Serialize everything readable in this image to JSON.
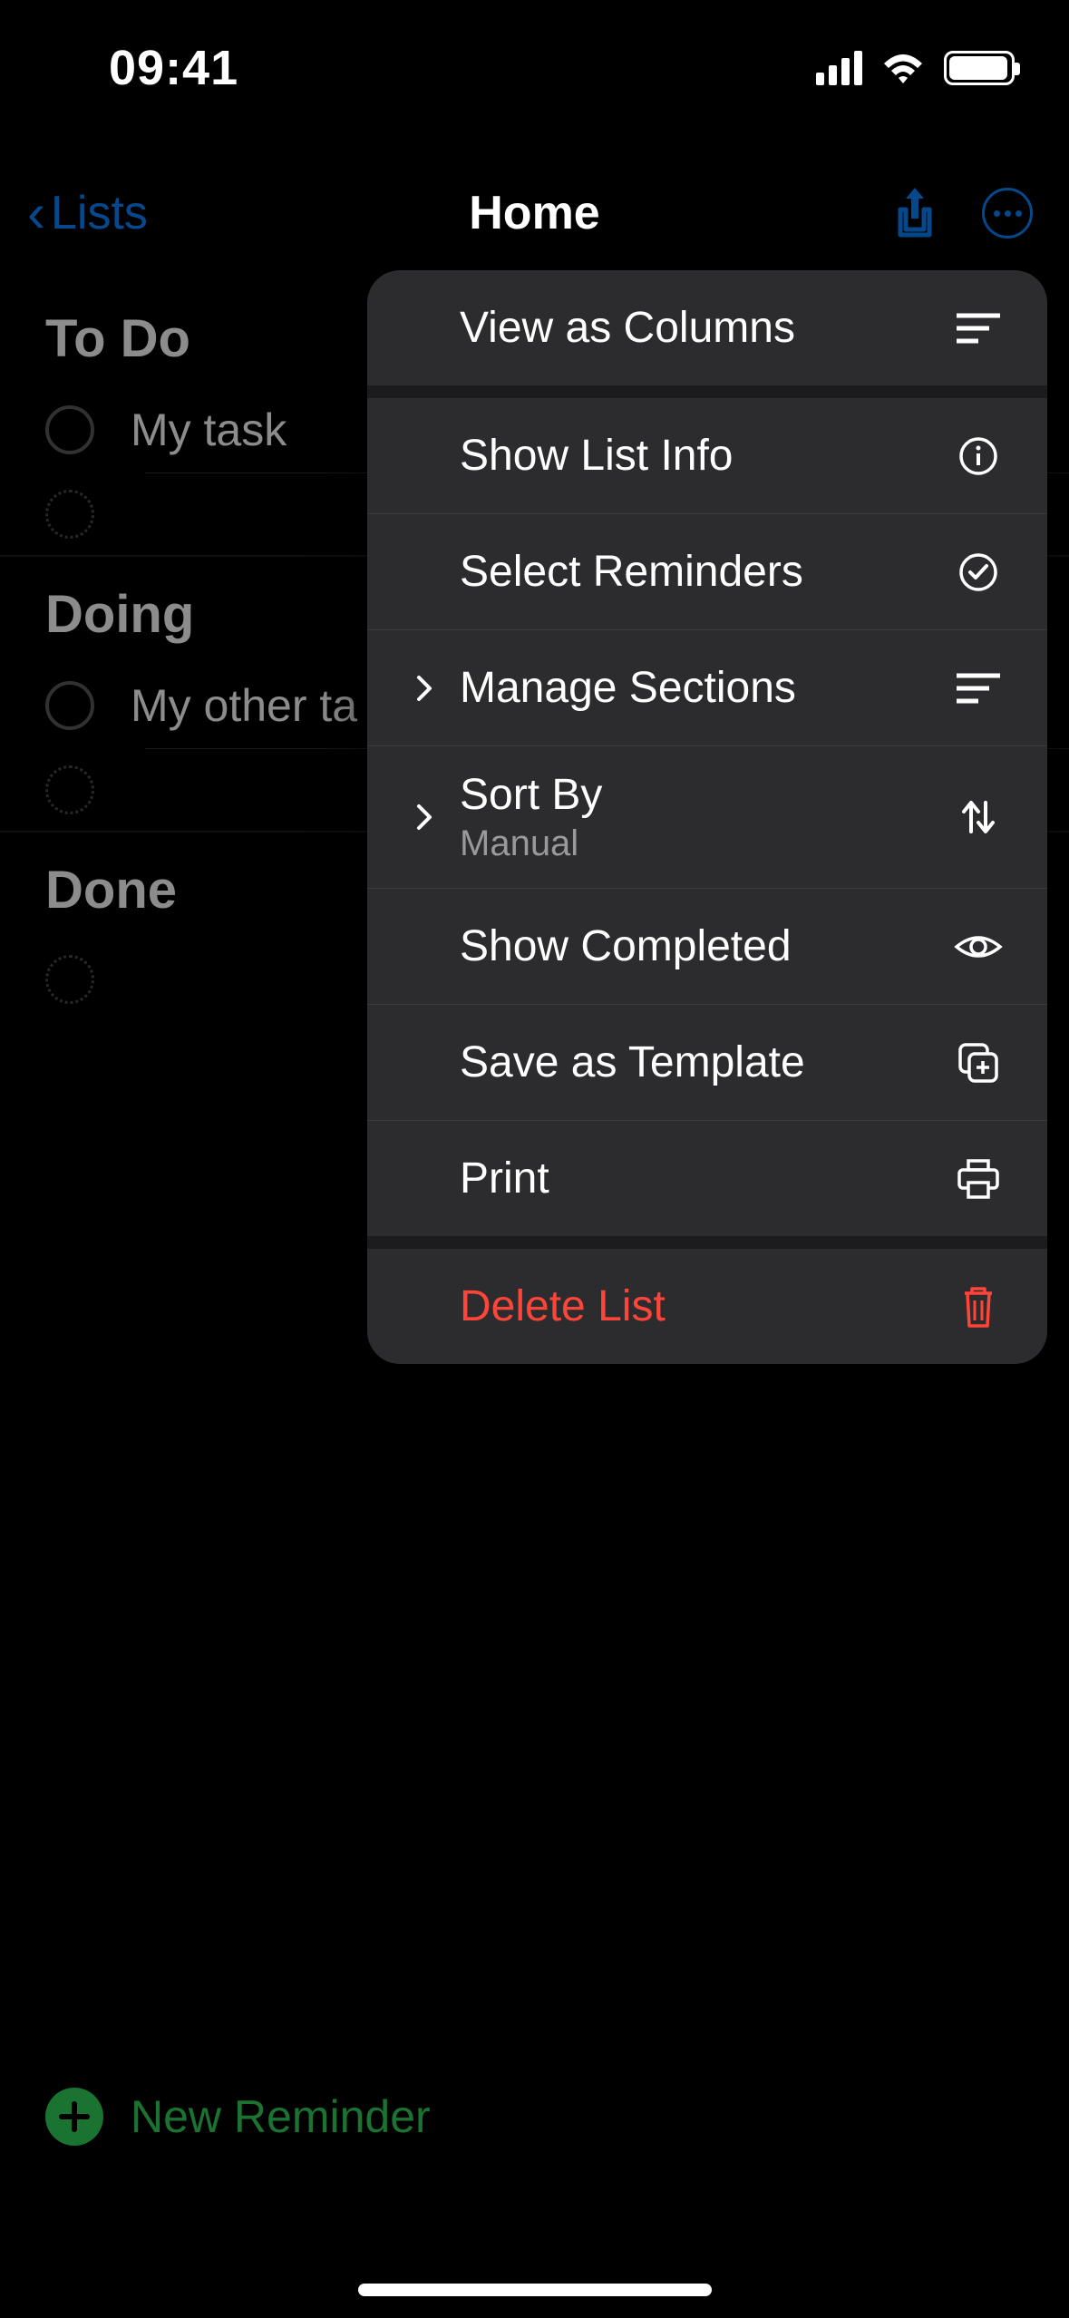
{
  "status": {
    "time": "09:41"
  },
  "nav": {
    "back_label": "Lists",
    "title": "Home"
  },
  "sections": [
    {
      "title": "To Do",
      "items": [
        "My task"
      ]
    },
    {
      "title": "Doing",
      "items": [
        "My other ta"
      ]
    },
    {
      "title": "Done",
      "items": []
    }
  ],
  "menu": {
    "view_columns": "View as Columns",
    "show_list_info": "Show List Info",
    "select_reminders": "Select Reminders",
    "manage_sections": "Manage Sections",
    "sort_by": "Sort By",
    "sort_by_value": "Manual",
    "show_completed": "Show Completed",
    "save_template": "Save as Template",
    "print": "Print",
    "delete_list": "Delete List"
  },
  "footer": {
    "new_reminder": "New Reminder"
  },
  "colors": {
    "accent_blue": "#0a84ff",
    "accent_green": "#30d158",
    "destructive": "#ff453a"
  }
}
